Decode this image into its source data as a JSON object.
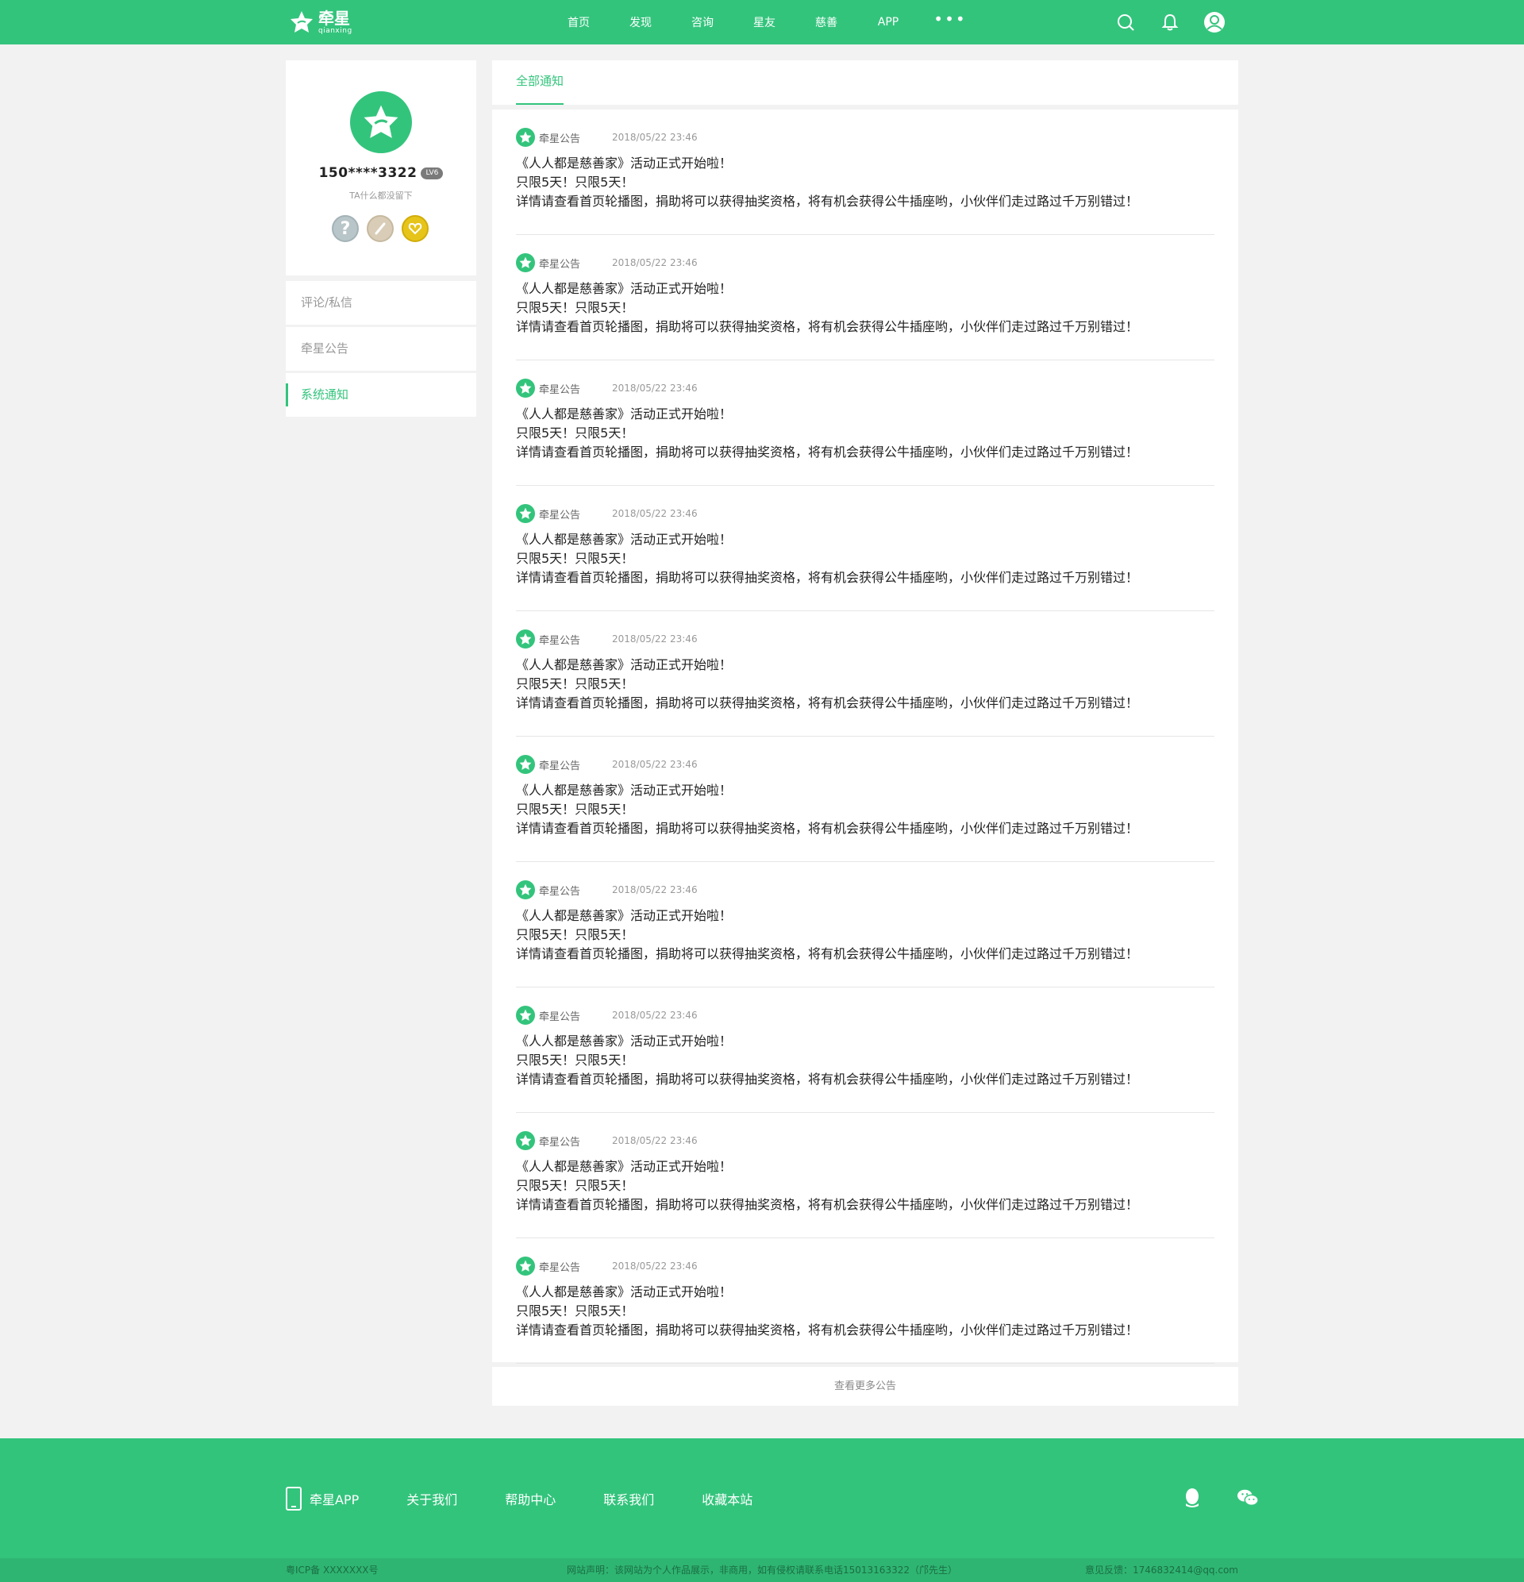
{
  "header": {
    "brand_cn": "牵星",
    "brand_en": "qianxing",
    "nav": [
      "首页",
      "发现",
      "咨询",
      "星友",
      "慈善",
      "APP"
    ],
    "more": "•••"
  },
  "profile": {
    "username": "150****3322",
    "level": "LV6",
    "bio": "TA什么都没留下"
  },
  "sidebar": {
    "items": [
      {
        "label": "评论/私信"
      },
      {
        "label": "牵星公告"
      },
      {
        "label": "系统通知"
      }
    ]
  },
  "main": {
    "tab": "全部通知",
    "notices": [
      {
        "source": "牵星公告",
        "time": "2018/05/22  23:46",
        "line1": "《人人都是慈善家》活动正式开始啦！",
        "line2": "只限5天！只限5天！",
        "line3": "详情请查看首页轮播图，捐助将可以获得抽奖资格，将有机会获得公牛插座哟，小伙伴们走过路过千万别错过！"
      },
      {
        "source": "牵星公告",
        "time": "2018/05/22  23:46",
        "line1": "《人人都是慈善家》活动正式开始啦！",
        "line2": "只限5天！只限5天！",
        "line3": "详情请查看首页轮播图，捐助将可以获得抽奖资格，将有机会获得公牛插座哟，小伙伴们走过路过千万别错过！"
      },
      {
        "source": "牵星公告",
        "time": "2018/05/22  23:46",
        "line1": "《人人都是慈善家》活动正式开始啦！",
        "line2": "只限5天！只限5天！",
        "line3": "详情请查看首页轮播图，捐助将可以获得抽奖资格，将有机会获得公牛插座哟，小伙伴们走过路过千万别错过！"
      },
      {
        "source": "牵星公告",
        "time": "2018/05/22  23:46",
        "line1": "《人人都是慈善家》活动正式开始啦！",
        "line2": "只限5天！只限5天！",
        "line3": "详情请查看首页轮播图，捐助将可以获得抽奖资格，将有机会获得公牛插座哟，小伙伴们走过路过千万别错过！"
      },
      {
        "source": "牵星公告",
        "time": "2018/05/22  23:46",
        "line1": "《人人都是慈善家》活动正式开始啦！",
        "line2": "只限5天！只限5天！",
        "line3": "详情请查看首页轮播图，捐助将可以获得抽奖资格，将有机会获得公牛插座哟，小伙伴们走过路过千万别错过！"
      },
      {
        "source": "牵星公告",
        "time": "2018/05/22  23:46",
        "line1": "《人人都是慈善家》活动正式开始啦！",
        "line2": "只限5天！只限5天！",
        "line3": "详情请查看首页轮播图，捐助将可以获得抽奖资格，将有机会获得公牛插座哟，小伙伴们走过路过千万别错过！"
      },
      {
        "source": "牵星公告",
        "time": "2018/05/22  23:46",
        "line1": "《人人都是慈善家》活动正式开始啦！",
        "line2": "只限5天！只限5天！",
        "line3": "详情请查看首页轮播图，捐助将可以获得抽奖资格，将有机会获得公牛插座哟，小伙伴们走过路过千万别错过！"
      },
      {
        "source": "牵星公告",
        "time": "2018/05/22  23:46",
        "line1": "《人人都是慈善家》活动正式开始啦！",
        "line2": "只限5天！只限5天！",
        "line3": "详情请查看首页轮播图，捐助将可以获得抽奖资格，将有机会获得公牛插座哟，小伙伴们走过路过千万别错过！"
      },
      {
        "source": "牵星公告",
        "time": "2018/05/22  23:46",
        "line1": "《人人都是慈善家》活动正式开始啦！",
        "line2": "只限5天！只限5天！",
        "line3": "详情请查看首页轮播图，捐助将可以获得抽奖资格，将有机会获得公牛插座哟，小伙伴们走过路过千万别错过！"
      },
      {
        "source": "牵星公告",
        "time": "2018/05/22  23:46",
        "line1": "《人人都是慈善家》活动正式开始啦！",
        "line2": "只限5天！只限5天！",
        "line3": "详情请查看首页轮播图，捐助将可以获得抽奖资格，将有机会获得公牛插座哟，小伙伴们走过路过千万别错过！"
      }
    ],
    "more_label": "查看更多公告"
  },
  "footer": {
    "links": [
      "牵星APP",
      "关于我们",
      "帮助中心",
      "联系我们",
      "收藏本站"
    ],
    "icp": "粤ICP备 XXXXXXX号",
    "statement": "网站声明：该网站为个人作品展示，非商用，如有侵权请联系电话15013163322（邝先生）",
    "feedback": "意见反馈：1746832414@qq.com"
  },
  "colors": {
    "accent": "#33c47c",
    "background": "#f2f2f2"
  }
}
